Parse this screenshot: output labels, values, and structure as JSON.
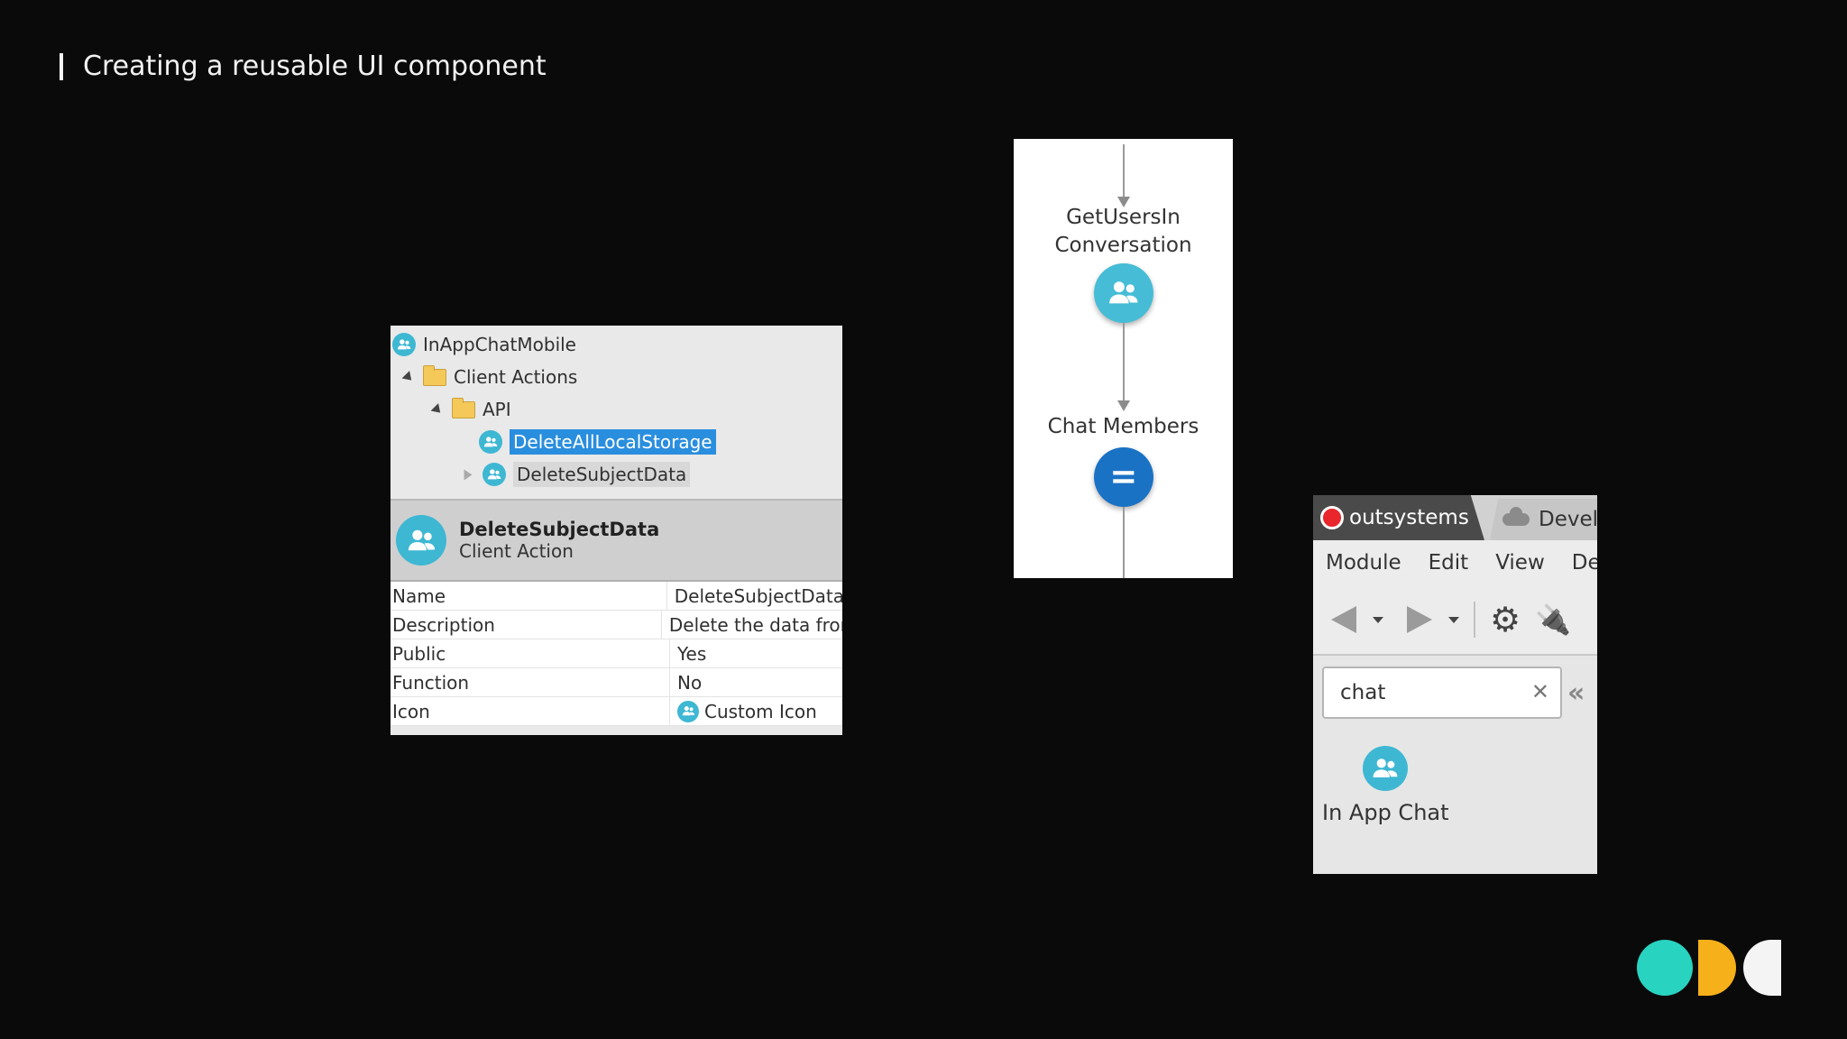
{
  "slide": {
    "title": "Creating a reusable UI component"
  },
  "tree": {
    "root": "InAppChatMobile",
    "folder": "Client Actions",
    "subfolder": "API",
    "items": [
      "DeleteAllLocalStorage",
      "DeleteSubjectData"
    ]
  },
  "properties": {
    "title": "DeleteSubjectData",
    "subtitle": "Client Action",
    "rows": [
      {
        "name": "Name",
        "value": "DeleteSubjectData"
      },
      {
        "name": "Description",
        "value": "Delete the data fror"
      },
      {
        "name": "Public",
        "value": "Yes"
      },
      {
        "name": "Function",
        "value": "No"
      },
      {
        "name": "Icon",
        "value": "Custom Icon"
      }
    ]
  },
  "flow": {
    "node1_label_line1": "GetUsersIn",
    "node1_label_line2": "Conversation",
    "node2_label": "Chat Members"
  },
  "studio": {
    "tab_active": "outsystems",
    "tab_inactive": "Devel",
    "menu": [
      "Module",
      "Edit",
      "View",
      "De"
    ],
    "search_value": "chat",
    "result_label": "In App Chat"
  },
  "colors": {
    "background": "#0a0a0a",
    "selection": "#2a8ede",
    "action_icon": "#3eb7d3",
    "assign_node": "#1a72c4",
    "brand_teal": "#28d3c0",
    "brand_yellow": "#f6b01a",
    "brand_white": "#f4f4f4"
  }
}
